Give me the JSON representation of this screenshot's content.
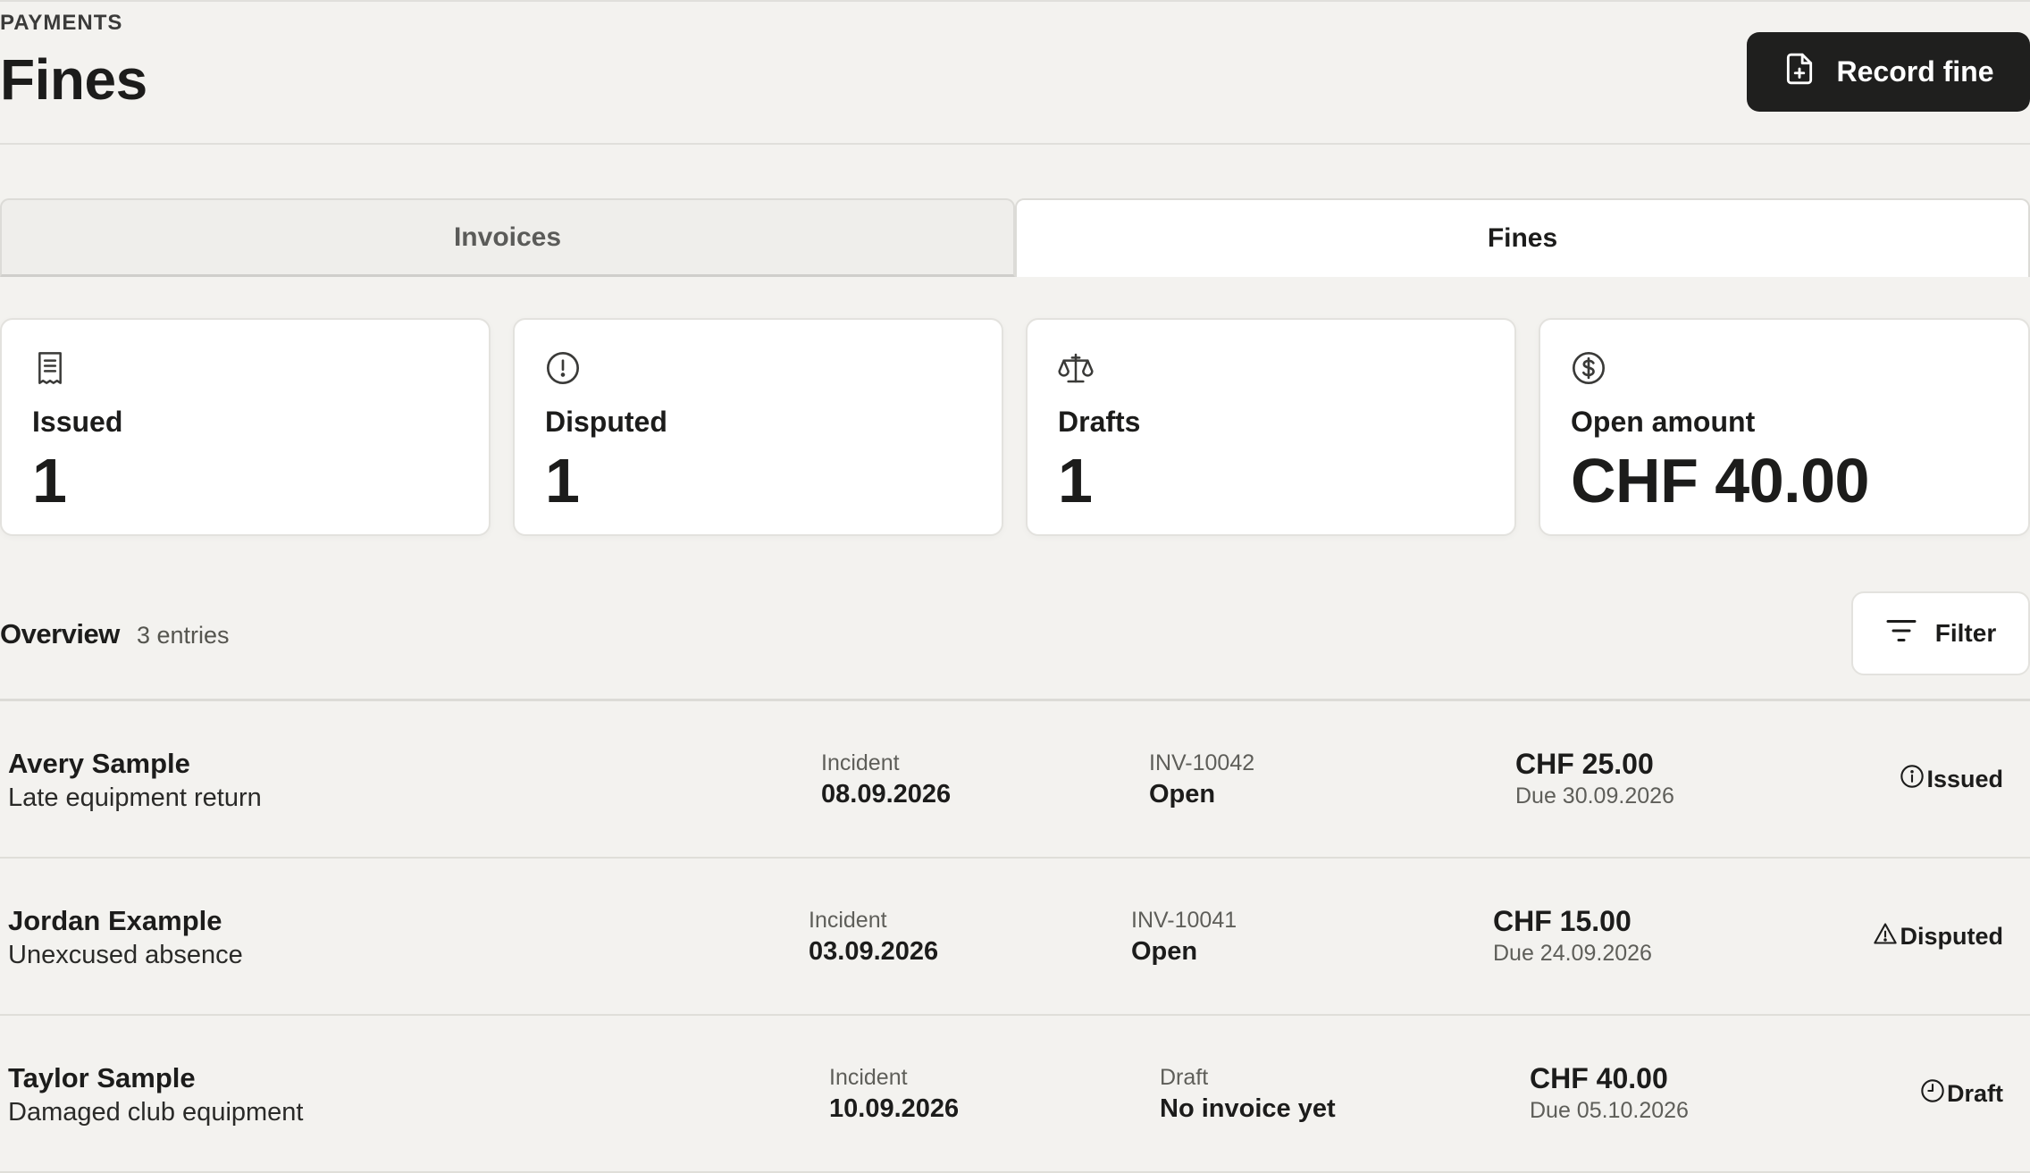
{
  "header": {
    "eyebrow": "PAYMENTS",
    "title": "Fines",
    "record_button_label": "Record fine"
  },
  "tabs": [
    {
      "label": "Invoices",
      "active": false
    },
    {
      "label": "Fines",
      "active": true
    }
  ],
  "stats": [
    {
      "icon": "receipt-icon",
      "label": "Issued",
      "value": "1"
    },
    {
      "icon": "alert-circle-icon",
      "label": "Disputed",
      "value": "1"
    },
    {
      "icon": "scale-icon",
      "label": "Drafts",
      "value": "1"
    },
    {
      "icon": "dollar-circle-icon",
      "label": "Open amount",
      "value": "CHF 40.00"
    }
  ],
  "overview": {
    "title": "Overview",
    "count": "3 entries",
    "filter_label": "Filter"
  },
  "rows": [
    {
      "name": "Avery Sample",
      "reason": "Late equipment return",
      "incident_label": "Incident",
      "incident_date": "08.09.2026",
      "invoice_ref": "INV-10042",
      "invoice_state": "Open",
      "amount": "CHF 25.00",
      "due": "Due 30.09.2026",
      "status": "Issued",
      "status_icon": "info-circle-icon"
    },
    {
      "name": "Jordan Example",
      "reason": "Unexcused absence",
      "incident_label": "Incident",
      "incident_date": "03.09.2026",
      "invoice_ref": "INV-10041",
      "invoice_state": "Open",
      "amount": "CHF 15.00",
      "due": "Due 24.09.2026",
      "status": "Disputed",
      "status_icon": "warning-triangle-icon"
    },
    {
      "name": "Taylor Sample",
      "reason": "Damaged club equipment",
      "incident_label": "Incident",
      "incident_date": "10.09.2026",
      "invoice_ref": "Draft",
      "invoice_state": "No invoice yet",
      "amount": "CHF 40.00",
      "due": "Due 05.10.2026",
      "status": "Draft",
      "status_icon": "clock-icon"
    }
  ]
}
